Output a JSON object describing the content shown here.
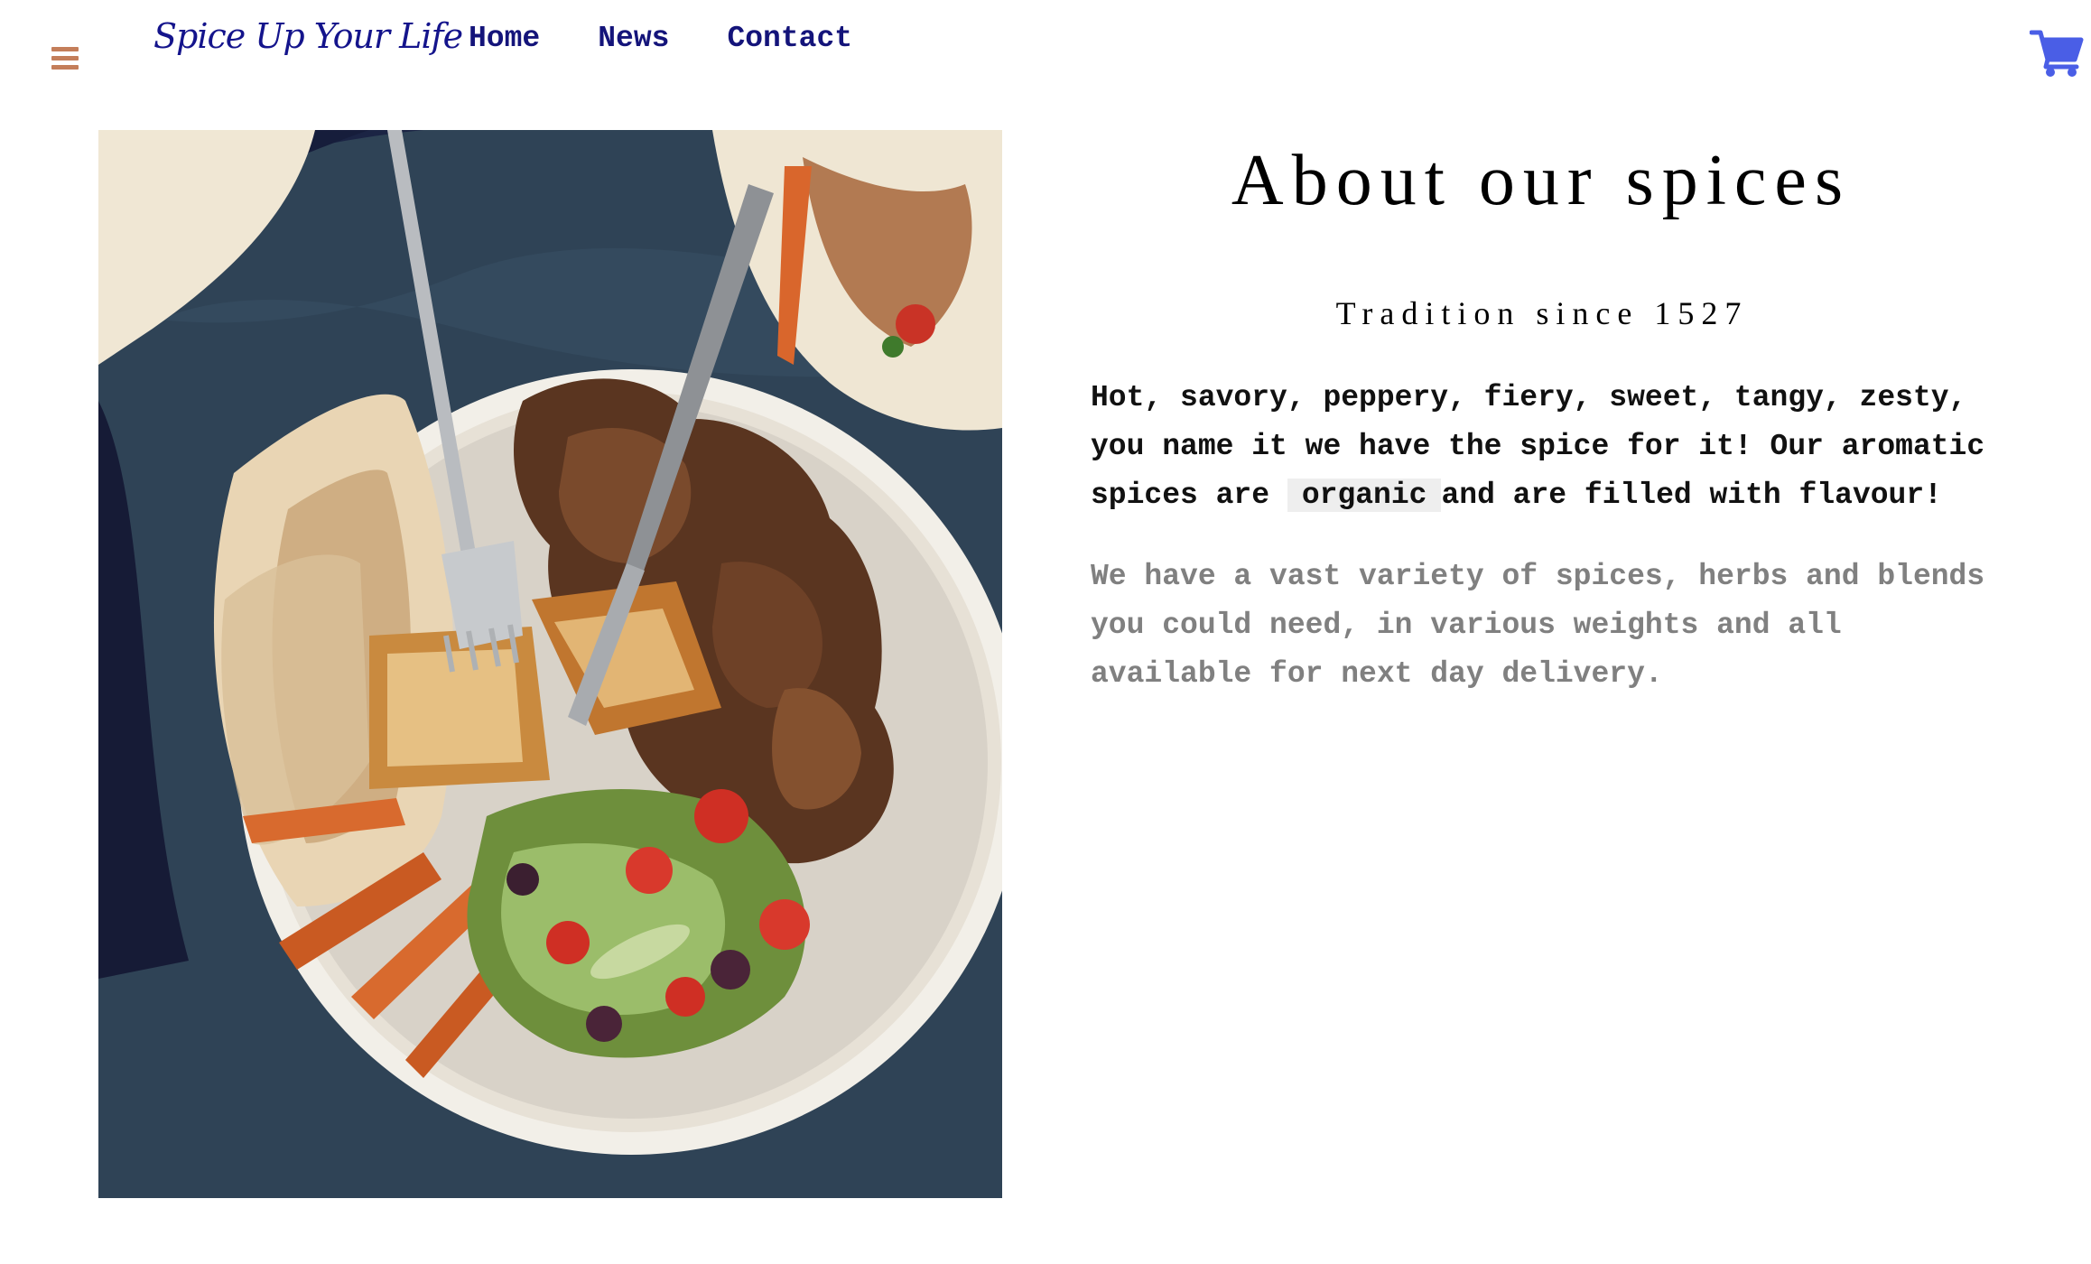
{
  "header": {
    "menu_icon": "hamburger-menu-icon",
    "brand": "Spice Up Your Life",
    "nav": [
      {
        "label": "Home"
      },
      {
        "label": "News"
      },
      {
        "label": "Contact"
      }
    ],
    "cart_icon": "shopping-cart-icon"
  },
  "main": {
    "image_icon": "food-platter-photo",
    "title": "About our spices",
    "subtitle": "Tradition since 1527",
    "intro_before": "Hot, savory, peppery, fiery, sweet, tangy, zesty, you name it we have the spice for it! Our aromatic spices are ",
    "intro_highlight": "organic",
    "intro_after": "and are filled with flavour!",
    "detail": "We have a vast variety of spices, herbs and blends you could need, in various weights and all available for next day delivery."
  },
  "colors": {
    "brand": "#14148c",
    "nav": "#14147a",
    "menu_icon": "#c47e5a",
    "cart_icon": "#4a5ee6",
    "muted_text": "#808080",
    "highlight_bg": "#eeeeee"
  }
}
